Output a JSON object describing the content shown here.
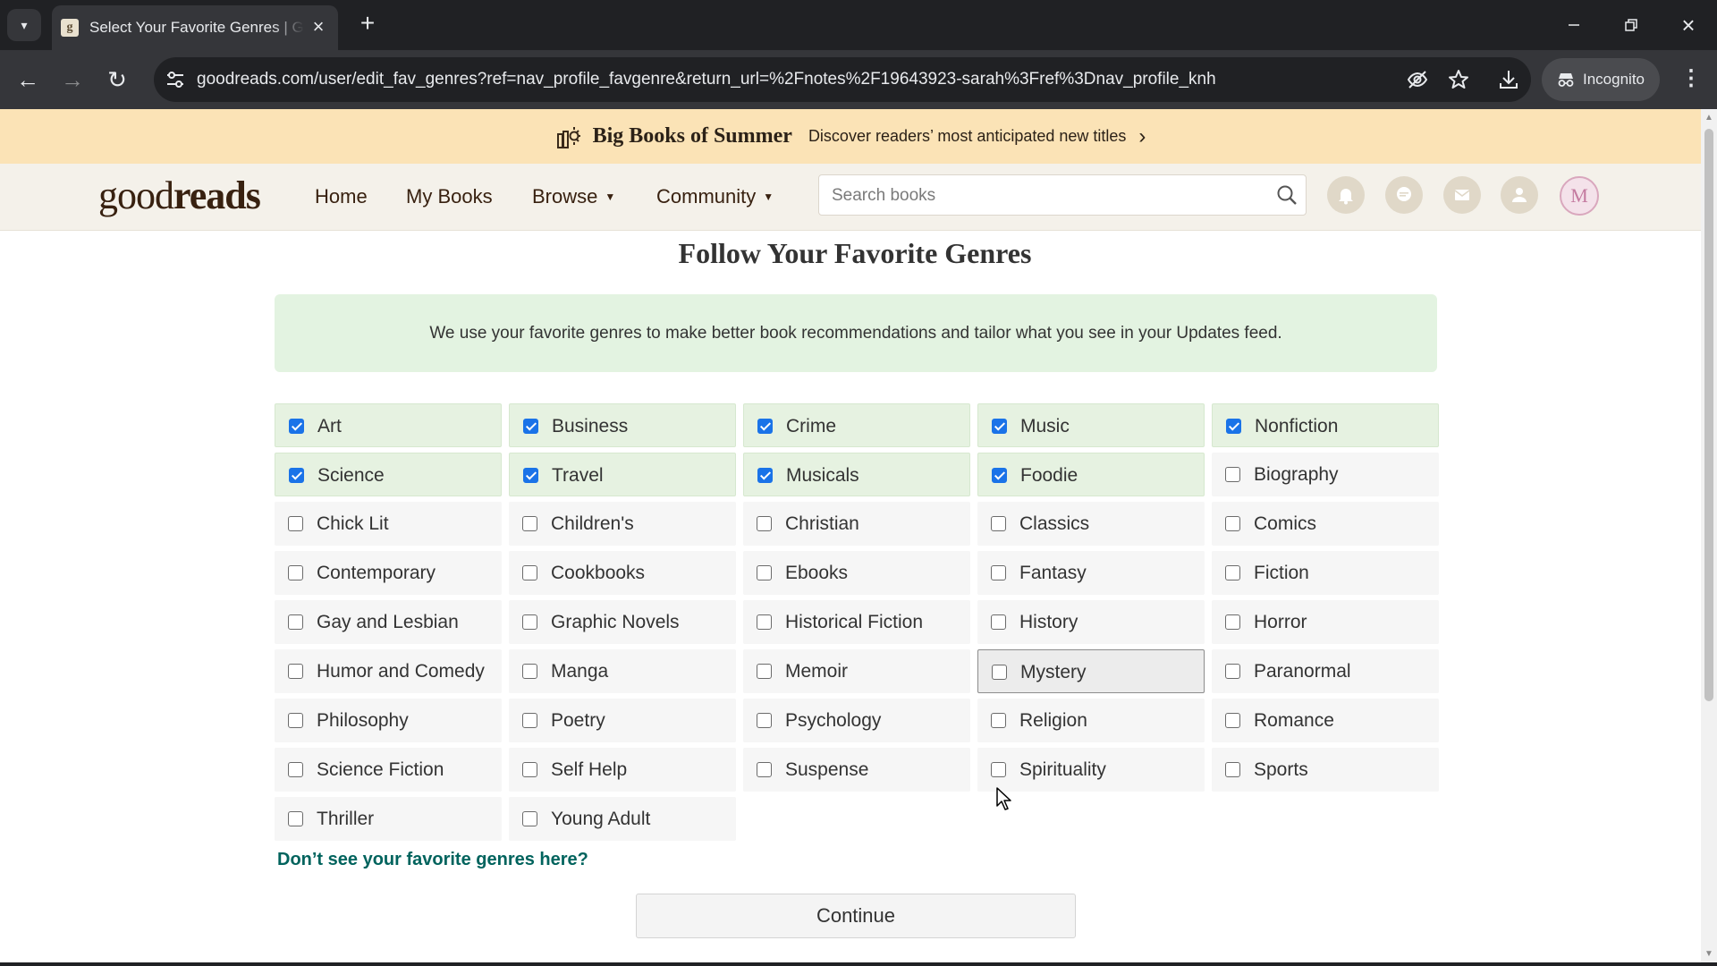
{
  "browser": {
    "tab_title": "Select Your Favorite Genres | Goodreads",
    "tab_favicon": "g",
    "url": "goodreads.com/user/edit_fav_genres?ref=nav_profile_favgenre&return_url=%2Fnotes%2F19643923-sarah%3Fref%3Dnav_profile_knh",
    "incognito_label": "Incognito",
    "icons": {
      "tab_list": "chevron-down-icon",
      "tab_close": "close-icon",
      "new_tab": "plus-icon",
      "minimize": "minimize-icon",
      "maximize": "restore-icon",
      "close_window": "close-icon",
      "back": "back-arrow-icon",
      "forward": "forward-arrow-icon",
      "reload": "reload-icon",
      "site_info": "tune-icon",
      "tracking": "eye-slash-icon",
      "bookmark": "star-icon",
      "downloads": "download-icon",
      "menu": "kebab-menu-icon"
    }
  },
  "promo": {
    "title": "Big Books of Summer",
    "subtitle": "Discover readers’ most anticipated new titles",
    "chevron": "›"
  },
  "header": {
    "logo_light": "good",
    "logo_bold": "reads",
    "nav": {
      "home": "Home",
      "my_books": "My Books",
      "browse": "Browse",
      "community": "Community"
    },
    "search_placeholder": "Search books",
    "avatar_letter": "M",
    "icon_names": [
      "notifications-icon",
      "discussions-icon",
      "messages-icon",
      "friends-icon"
    ]
  },
  "page": {
    "title": "Follow Your Favorite Genres",
    "info": "We use your favorite genres to make better book recommendations and tailor what you see in your Updates feed.",
    "more_link": "Don’t see your favorite genres here?",
    "continue_label": "Continue"
  },
  "genres": [
    {
      "label": "Art",
      "checked": true
    },
    {
      "label": "Business",
      "checked": true
    },
    {
      "label": "Crime",
      "checked": true
    },
    {
      "label": "Music",
      "checked": true
    },
    {
      "label": "Nonfiction",
      "checked": true
    },
    {
      "label": "Science",
      "checked": true
    },
    {
      "label": "Travel",
      "checked": true
    },
    {
      "label": "Musicals",
      "checked": true
    },
    {
      "label": "Foodie",
      "checked": true
    },
    {
      "label": "Biography",
      "checked": false
    },
    {
      "label": "Chick Lit",
      "checked": false
    },
    {
      "label": "Children's",
      "checked": false
    },
    {
      "label": "Christian",
      "checked": false
    },
    {
      "label": "Classics",
      "checked": false
    },
    {
      "label": "Comics",
      "checked": false
    },
    {
      "label": "Contemporary",
      "checked": false
    },
    {
      "label": "Cookbooks",
      "checked": false
    },
    {
      "label": "Ebooks",
      "checked": false
    },
    {
      "label": "Fantasy",
      "checked": false
    },
    {
      "label": "Fiction",
      "checked": false
    },
    {
      "label": "Gay and Lesbian",
      "checked": false
    },
    {
      "label": "Graphic Novels",
      "checked": false
    },
    {
      "label": "Historical Fiction",
      "checked": false
    },
    {
      "label": "History",
      "checked": false
    },
    {
      "label": "Horror",
      "checked": false
    },
    {
      "label": "Humor and Comedy",
      "checked": false
    },
    {
      "label": "Manga",
      "checked": false
    },
    {
      "label": "Memoir",
      "checked": false
    },
    {
      "label": "Mystery",
      "checked": false,
      "hovered": true
    },
    {
      "label": "Paranormal",
      "checked": false
    },
    {
      "label": "Philosophy",
      "checked": false
    },
    {
      "label": "Poetry",
      "checked": false
    },
    {
      "label": "Psychology",
      "checked": false
    },
    {
      "label": "Religion",
      "checked": false
    },
    {
      "label": "Romance",
      "checked": false
    },
    {
      "label": "Science Fiction",
      "checked": false
    },
    {
      "label": "Self Help",
      "checked": false
    },
    {
      "label": "Suspense",
      "checked": false
    },
    {
      "label": "Spirituality",
      "checked": false
    },
    {
      "label": "Sports",
      "checked": false
    },
    {
      "label": "Thriller",
      "checked": false
    },
    {
      "label": "Young Adult",
      "checked": false
    }
  ]
}
